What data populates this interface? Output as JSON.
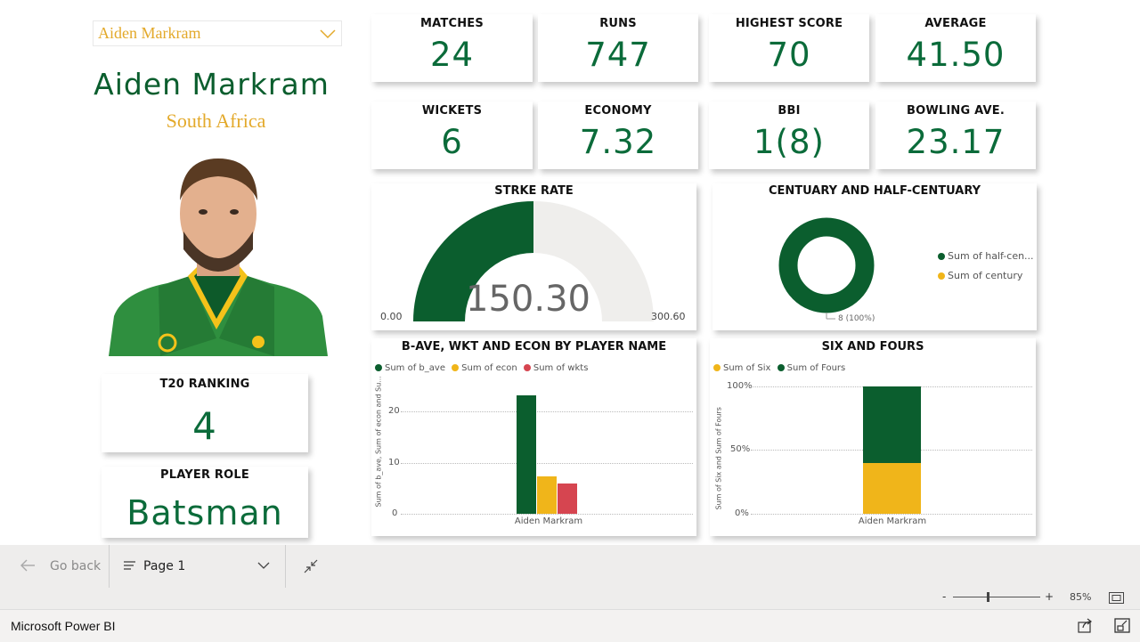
{
  "player": {
    "selector_value": "Aiden Markram",
    "name": "Aiden Markram",
    "country": "South Africa"
  },
  "kpis": {
    "matches": {
      "label": "MATCHES",
      "value": "24"
    },
    "runs": {
      "label": "RUNS",
      "value": "747"
    },
    "highest_score": {
      "label": "HIGHEST SCORE",
      "value": "70"
    },
    "average": {
      "label": "AVERAGE",
      "value": "41.50"
    },
    "wickets": {
      "label": "WICKETS",
      "value": "6"
    },
    "economy": {
      "label": "ECONOMY",
      "value": "7.32"
    },
    "bbi": {
      "label": "BBI",
      "value": "1(8)"
    },
    "bowling_ave": {
      "label": "BOWLING AVE.",
      "value": "23.17"
    }
  },
  "ranking": {
    "label": "T20 RANKING",
    "value": "4"
  },
  "role": {
    "label": "PLAYER ROLE",
    "value": "Batsman"
  },
  "strike_rate": {
    "title": "STRKE RATE",
    "value_text": "150.30",
    "min_text": "0.00",
    "max_text": "300.60"
  },
  "century": {
    "title": "CENTUARY AND HALF-CENTUARY",
    "legend": [
      "Sum of half-cen...",
      "Sum of century"
    ],
    "label": "8 (100%)"
  },
  "bave_chart": {
    "title": "B-AVE, WKT AND ECON BY PLAYER NAME",
    "legend": [
      "Sum of b_ave",
      "Sum of econ",
      "Sum of wkts"
    ],
    "ylabel": "Sum of b_ave, Sum of econ and Su...",
    "yticks": [
      "20",
      "10",
      "0"
    ],
    "category": "Aiden Markram"
  },
  "six_chart": {
    "title": "SIX AND FOURS",
    "legend": [
      "Sum of Six",
      "Sum of Fours"
    ],
    "ylabel": "Sum of Six and Sum of Fours",
    "yticks": [
      "100%",
      "50%",
      "0%"
    ],
    "category": "Aiden Markram"
  },
  "chart_data": [
    {
      "type": "gauge",
      "title": "STRKE RATE",
      "value": 150.3,
      "min": 0.0,
      "max": 300.6
    },
    {
      "type": "pie",
      "title": "CENTUARY AND HALF-CENTUARY",
      "series": [
        {
          "name": "Sum of half-cen...",
          "values": [
            8
          ]
        },
        {
          "name": "Sum of century",
          "values": [
            0
          ]
        }
      ],
      "data_label": "8 (100%)"
    },
    {
      "type": "bar",
      "title": "B-AVE, WKT AND ECON BY PLAYER NAME",
      "categories": [
        "Aiden Markram"
      ],
      "series": [
        {
          "name": "Sum of b_ave",
          "values": [
            23.17
          ]
        },
        {
          "name": "Sum of econ",
          "values": [
            7.32
          ]
        },
        {
          "name": "Sum of wkts",
          "values": [
            6
          ]
        }
      ],
      "ylabel": "Sum of b_ave, Sum of econ and Su...",
      "ylim": [
        0,
        25
      ],
      "grid": true,
      "legend": "top-left"
    },
    {
      "type": "bar",
      "stacked": "percent",
      "title": "SIX AND FOURS",
      "categories": [
        "Aiden Markram"
      ],
      "series": [
        {
          "name": "Sum of Six",
          "values": [
            40
          ]
        },
        {
          "name": "Sum of Fours",
          "values": [
            60
          ]
        }
      ],
      "ylabel": "Sum of Six and Sum of Fours",
      "ylim": [
        0,
        100
      ],
      "grid": true,
      "legend": "top-left"
    }
  ],
  "colors": {
    "green": "#0b5e2e",
    "kpi_green": "#0b6b3a",
    "gold": "#f0b51a",
    "red": "#d64550",
    "gauge_track": "#efeeec"
  },
  "footer": {
    "go_back": "Go back",
    "page": "Page 1",
    "zoom": "85%",
    "zoom_minus": "-",
    "zoom_plus": "+",
    "app_name": "Microsoft Power BI"
  },
  "icons": {
    "back": "arrow-left-icon",
    "page_menu": "hamburger-icon",
    "page_dropdown": "chevron-down-icon",
    "collapse": "collapse-arrows-icon",
    "fit": "fit-to-page-icon",
    "share": "share-icon",
    "popout": "popout-icon"
  }
}
